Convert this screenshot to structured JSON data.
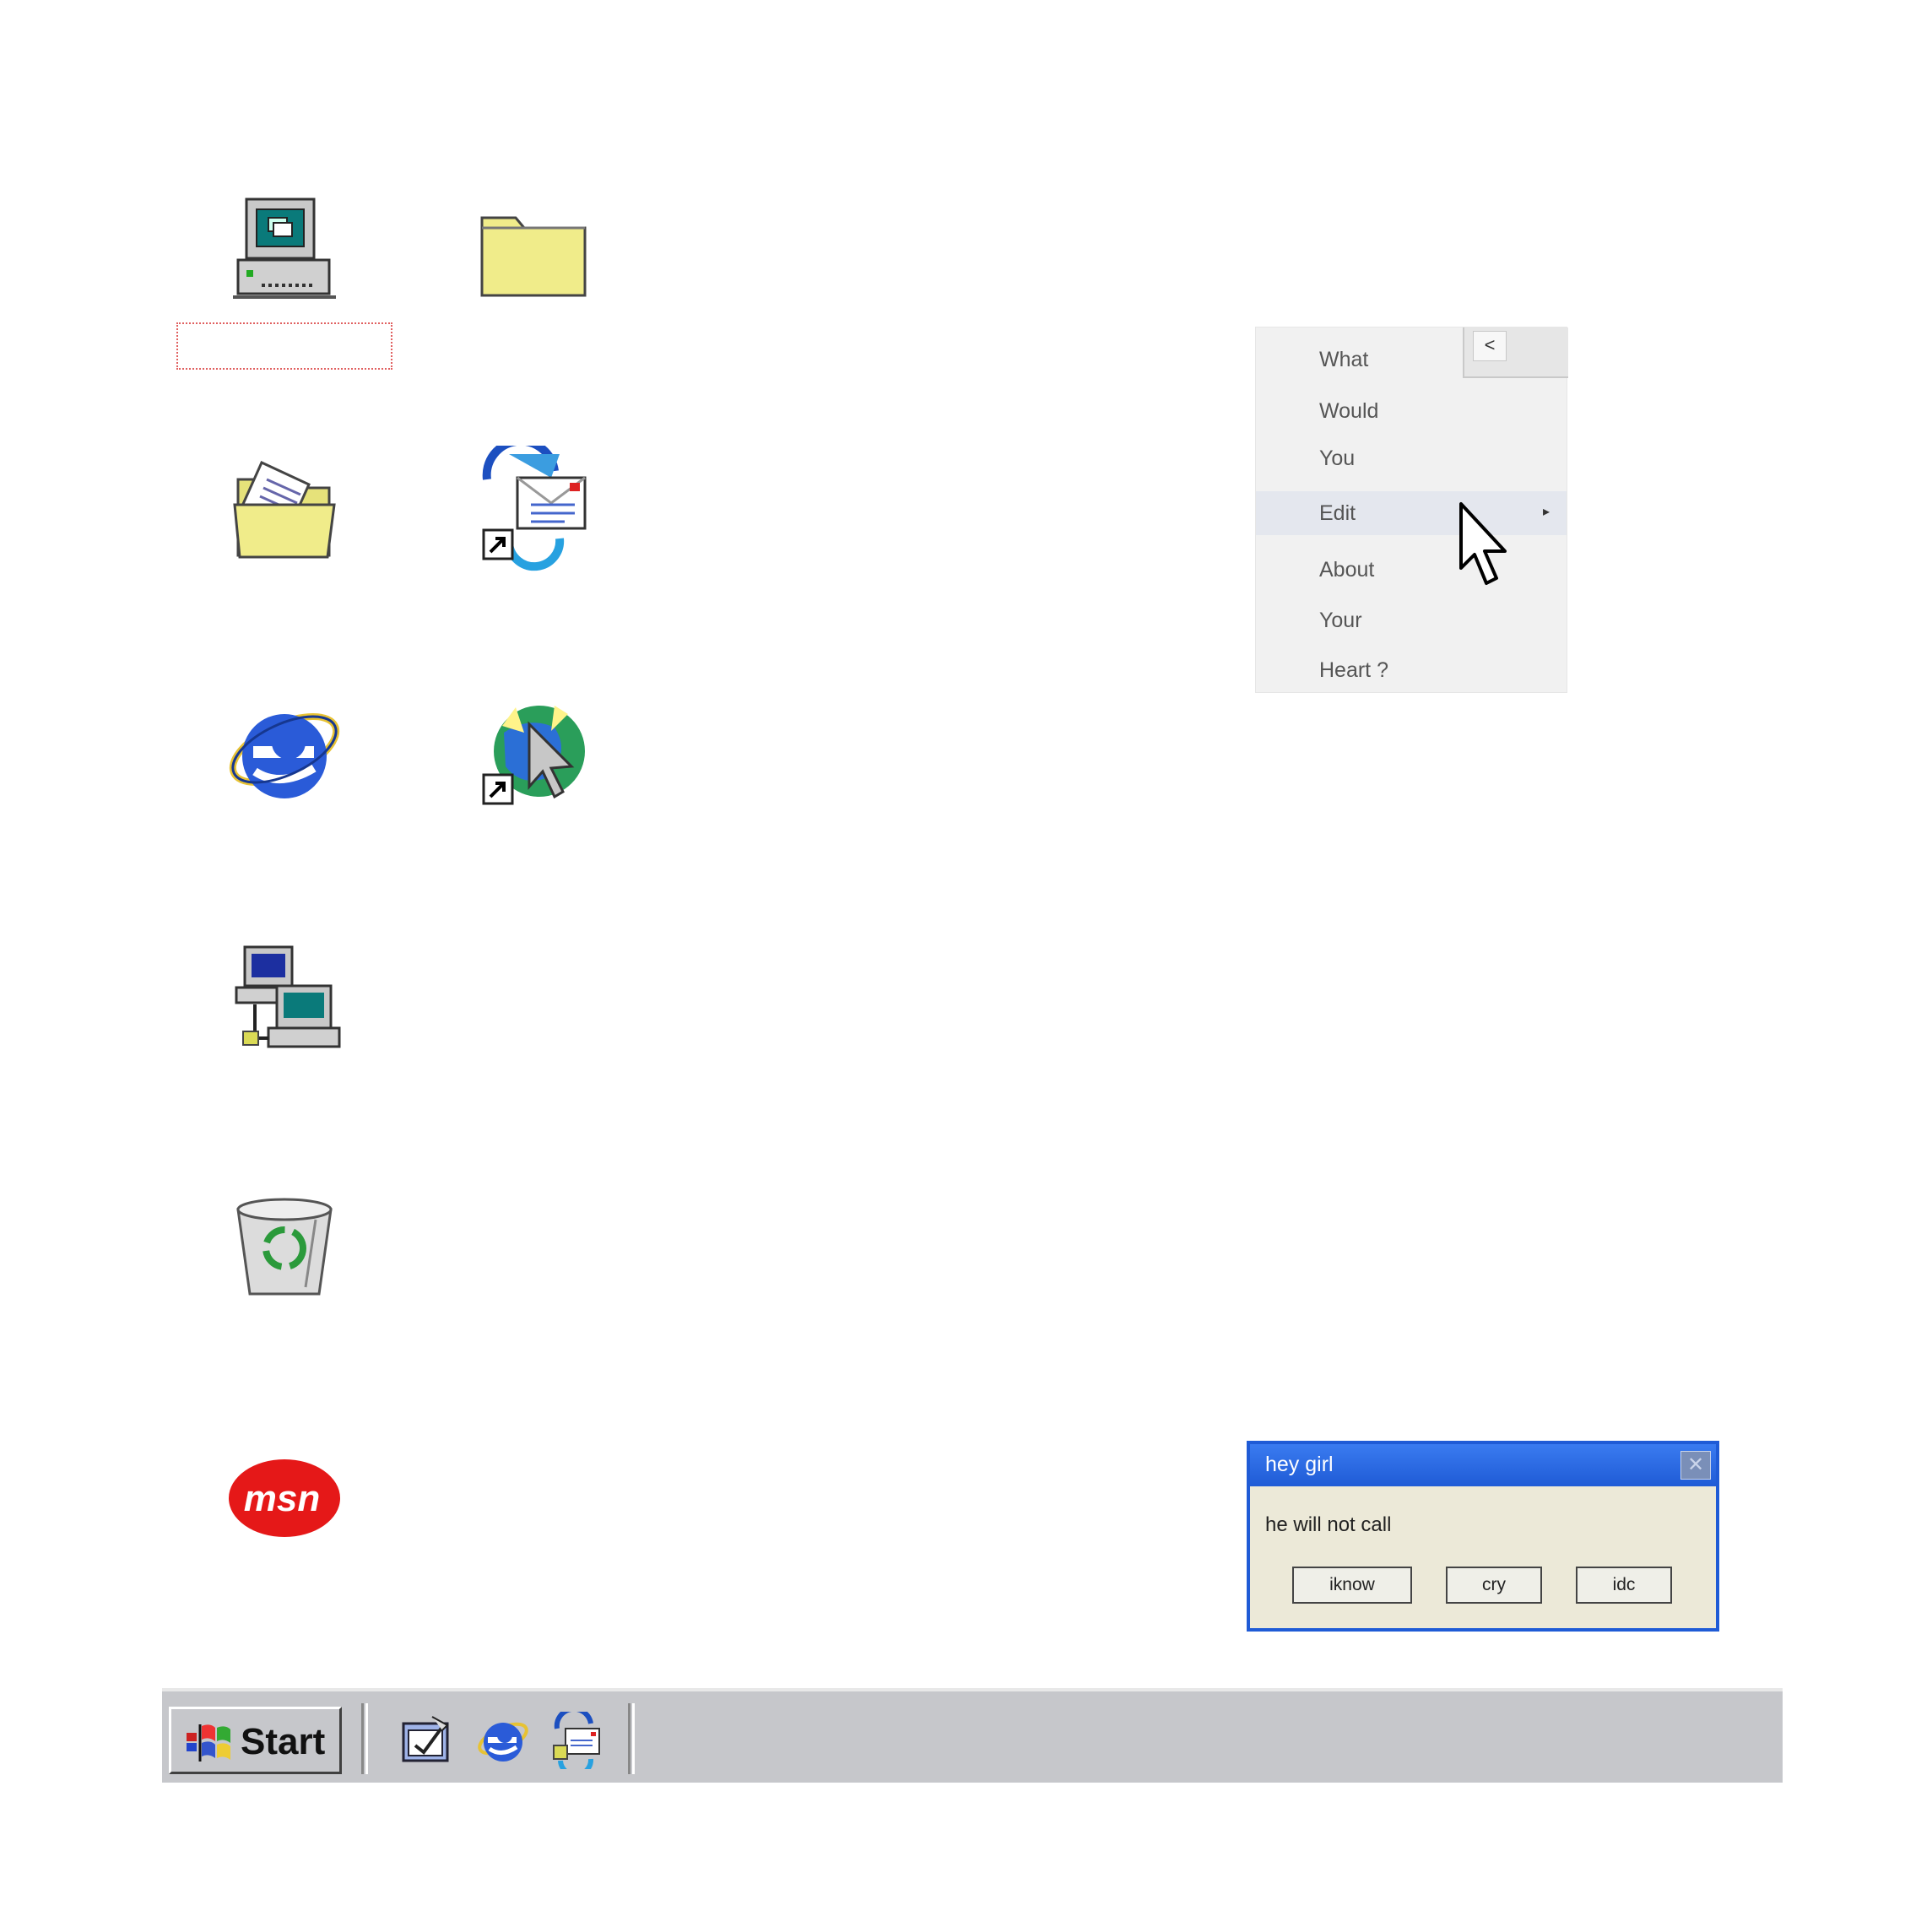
{
  "desktop": {
    "icons": [
      {
        "name": "my-computer-icon"
      },
      {
        "name": "folder-icon"
      },
      {
        "name": "my-documents-icon"
      },
      {
        "name": "outlook-express-shortcut-icon"
      },
      {
        "name": "internet-explorer-icon"
      },
      {
        "name": "connect-to-internet-shortcut-icon"
      },
      {
        "name": "network-neighborhood-icon"
      },
      {
        "name": "recycle-bin-icon"
      },
      {
        "name": "msn-icon"
      }
    ]
  },
  "context_menu": {
    "items": [
      {
        "label": "What"
      },
      {
        "label": "Would"
      },
      {
        "label": "You"
      },
      {
        "label": "Edit",
        "submenu_arrow": "▸",
        "highlighted": true
      },
      {
        "label": "About"
      },
      {
        "label": "Your"
      },
      {
        "label": "Heart ?"
      }
    ],
    "back_glyph": "<"
  },
  "dialog": {
    "title": "hey girl",
    "close_glyph": "✕",
    "message": "he will not call",
    "buttons": {
      "iknow": "iknow",
      "cry": "cry",
      "idc": "idc"
    }
  },
  "taskbar": {
    "start_label": "Start",
    "quick_launch": [
      "show-desktop-icon",
      "internet-explorer-icon",
      "outlook-express-icon"
    ]
  },
  "colors": {
    "titlebar": "#1f5bd6",
    "taskbar": "#c6c7cb",
    "dialog_bg": "#ece9d8",
    "folder_yellow": "#f0ec8a"
  }
}
